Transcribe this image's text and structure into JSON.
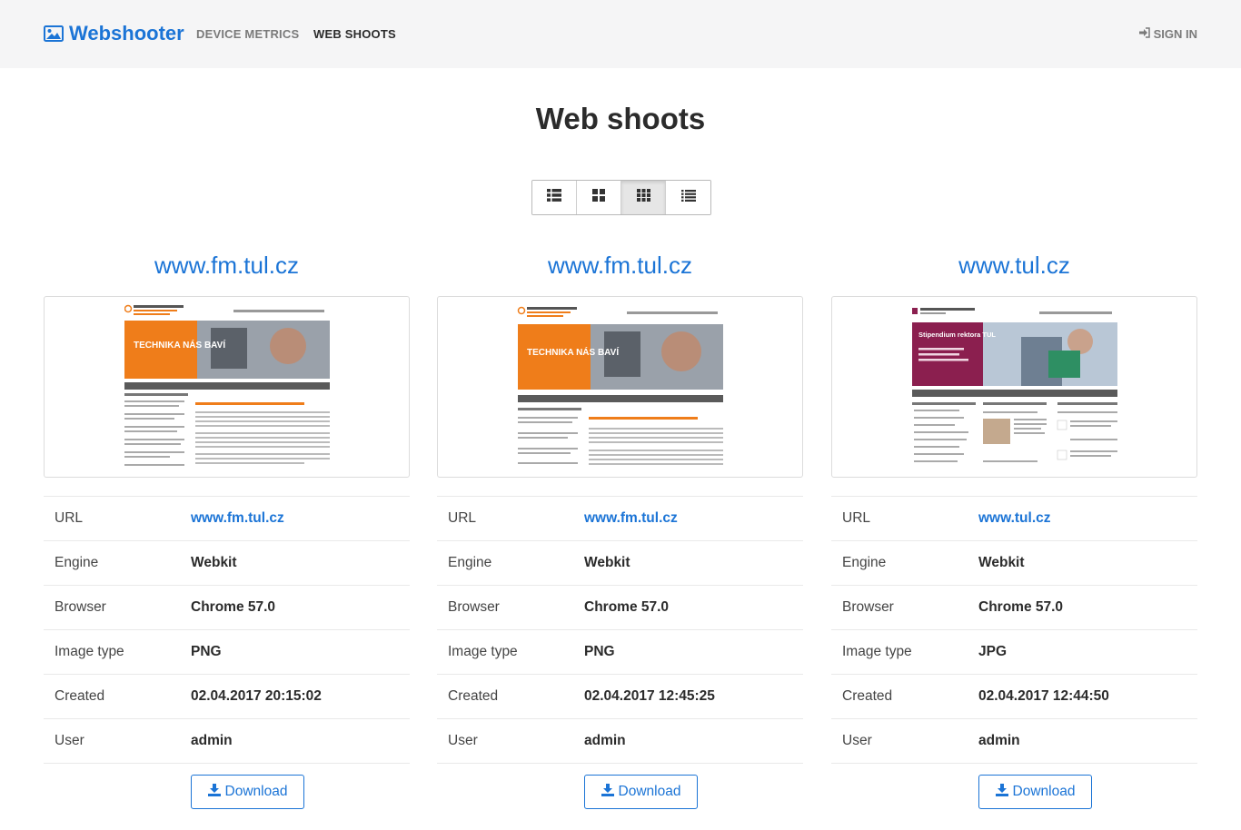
{
  "nav": {
    "brand": "Webshooter",
    "links": [
      "DEVICE METRICS",
      "WEB SHOOTS"
    ],
    "signin": "SIGN IN"
  },
  "page": {
    "title": "Web shoots"
  },
  "view_toggle": {
    "options": [
      "list-large-icon",
      "grid-large-icon",
      "grid-small-icon",
      "list-icon"
    ],
    "active_index": 2
  },
  "labels": {
    "url": "URL",
    "engine": "Engine",
    "browser": "Browser",
    "image_type": "Image type",
    "created": "Created",
    "user": "User",
    "download": "Download"
  },
  "shoots": [
    {
      "title": "www.fm.tul.cz",
      "url": "www.fm.tul.cz",
      "engine": "Webkit",
      "browser": "Chrome 57.0",
      "image_type": "PNG",
      "created": "02.04.2017 20:15:02",
      "user": "admin",
      "hero": "TECHNIKA NÁS BAVÍ"
    },
    {
      "title": "www.fm.tul.cz",
      "url": "www.fm.tul.cz",
      "engine": "Webkit",
      "browser": "Chrome 57.0",
      "image_type": "PNG",
      "created": "02.04.2017 12:45:25",
      "user": "admin",
      "hero": "TECHNIKA NÁS BAVÍ"
    },
    {
      "title": "www.tul.cz",
      "url": "www.tul.cz",
      "engine": "Webkit",
      "browser": "Chrome 57.0",
      "image_type": "JPG",
      "created": "02.04.2017 12:44:50",
      "user": "admin",
      "hero": "Stipendium rektora TUL"
    }
  ],
  "colors": {
    "accent": "#1b74d6",
    "navbar_bg": "#f5f5f6",
    "hero_orange": "#ef7d1a",
    "hero_purple": "#8b1f4f"
  }
}
